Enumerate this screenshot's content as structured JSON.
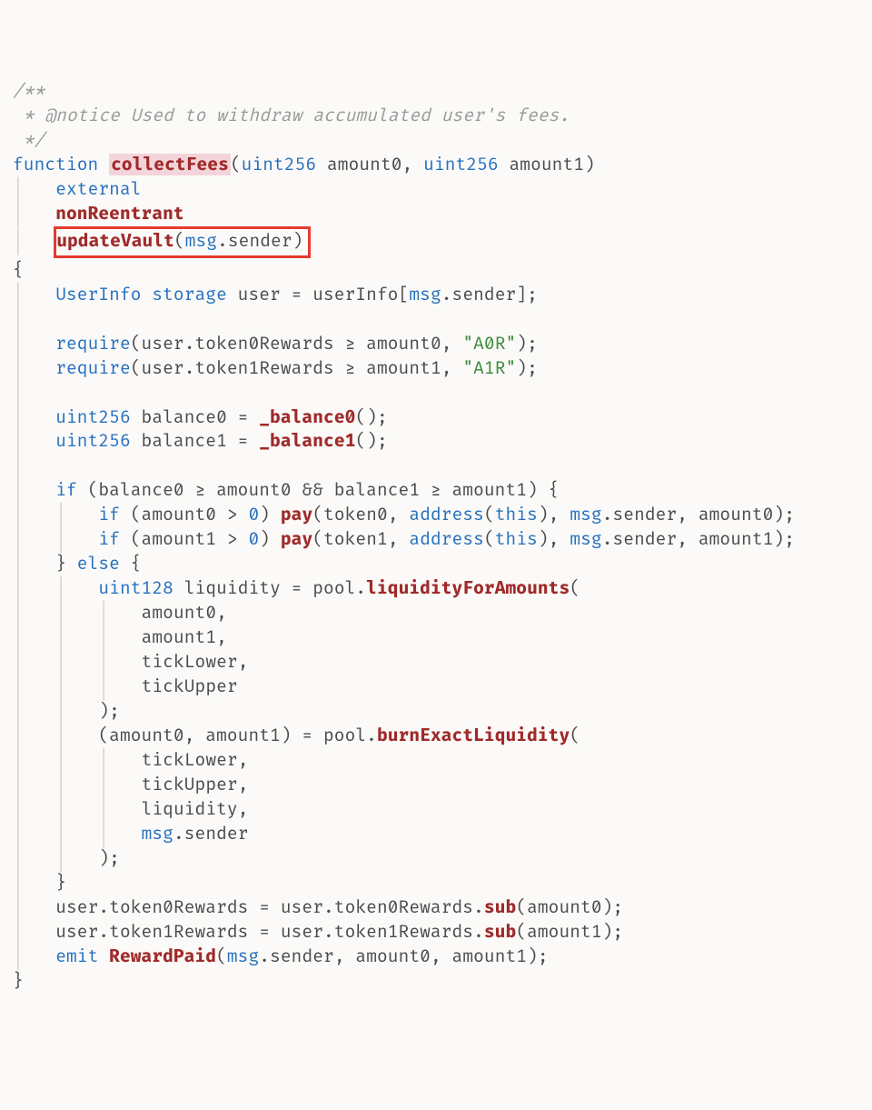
{
  "comment": {
    "l1": "/**",
    "l2": " * @notice Used to withdraw accumulated user's fees.",
    "l3": " */"
  },
  "sig": {
    "kw_function": "function",
    "name": "collectFees",
    "params_open": "(",
    "p1_type": "uint256",
    "p1_name": " amount0, ",
    "p2_type": "uint256",
    "p2_name": " amount1",
    "params_close": ")",
    "mod_external": "external",
    "mod_nonReentrant": "nonReentrant",
    "mod_updateVault": "updateVault",
    "uv_open": "(",
    "uv_msg": "msg",
    "uv_sender": ".sender",
    "uv_close": ")"
  },
  "body": {
    "open_brace": "{",
    "l_user_type": "UserInfo",
    "l_user_storage": " storage",
    "l_user_rest": " user = userInfo[",
    "l_user_msg": "msg",
    "l_user_tail": ".sender];",
    "req1_kw": "require",
    "req1_body": "(user.token0Rewards ≥ amount0, ",
    "req1_str": "\"A0R\"",
    "req1_end": ");",
    "req2_kw": "require",
    "req2_body": "(user.token1Rewards ≥ amount1, ",
    "req2_str": "\"A1R\"",
    "req2_end": ");",
    "b0_type": "uint256",
    "b0_mid": " balance0 = ",
    "b0_fn": "_balance0",
    "b0_end": "();",
    "b1_type": "uint256",
    "b1_mid": " balance1 = ",
    "b1_fn": "_balance1",
    "b1_end": "();",
    "if_kw": "if",
    "if_cond": " (balance0 ≥ amount0 && balance1 ≥ amount1) {",
    "if_a0_kw": "if",
    "if_a0_cond": " (amount0 > ",
    "if_a0_zero": "0",
    "if_a0_close": ") ",
    "if_a0_fn": "pay",
    "if_a0_args_a": "(token0, ",
    "if_a0_addr": "address",
    "if_a0_args_b": "(",
    "if_a0_this": "this",
    "if_a0_args_c": "), ",
    "if_a0_msg": "msg",
    "if_a0_args_d": ".sender, amount0);",
    "if_a1_kw": "if",
    "if_a1_cond": " (amount1 > ",
    "if_a1_zero": "0",
    "if_a1_close": ") ",
    "if_a1_fn": "pay",
    "if_a1_args_a": "(token1, ",
    "if_a1_addr": "address",
    "if_a1_args_b": "(",
    "if_a1_this": "this",
    "if_a1_args_c": "), ",
    "if_a1_msg": "msg",
    "if_a1_args_d": ".sender, amount1);",
    "else_line_a": "} ",
    "else_kw": "else",
    "else_line_b": " {",
    "liq_type": "uint128",
    "liq_mid": " liquidity = pool.",
    "liq_fn": "liquidityForAmounts",
    "liq_open": "(",
    "liq_arg1": "amount0,",
    "liq_arg2": "amount1,",
    "liq_arg3": "tickLower,",
    "liq_arg4": "tickUpper",
    "liq_close": ");",
    "burn_lhs": "(amount0, amount1) = pool.",
    "burn_fn": "burnExactLiquidity",
    "burn_open": "(",
    "burn_arg1": "tickLower,",
    "burn_arg2": "tickUpper,",
    "burn_arg3": "liquidity,",
    "burn_arg4_msg": "msg",
    "burn_arg4_tail": ".sender",
    "burn_close": ");",
    "else_close": "}",
    "u0_a": "user.token0Rewards = user.token0Rewards.",
    "u0_fn": "sub",
    "u0_b": "(amount0);",
    "u1_a": "user.token1Rewards = user.token1Rewards.",
    "u1_fn": "sub",
    "u1_b": "(amount1);",
    "emit_kw": "emit",
    "emit_sp": " ",
    "emit_fn": "RewardPaid",
    "emit_args_a": "(",
    "emit_msg": "msg",
    "emit_args_b": ".sender, amount0, amount1);",
    "close_brace": "}"
  },
  "guide": "│"
}
